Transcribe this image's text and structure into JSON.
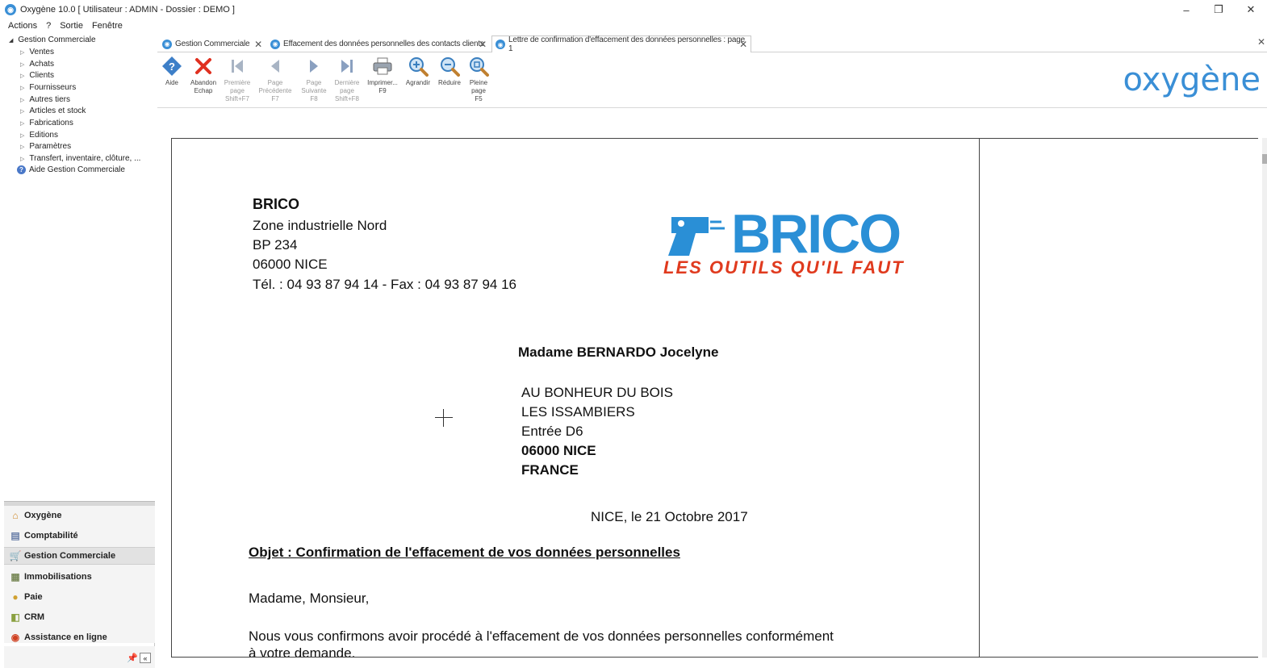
{
  "window": {
    "title": "Oxygène 10.0 [ Utilisateur : ADMIN - Dossier : DEMO ]",
    "minimize": "–",
    "maximize": "❐",
    "close": "✕"
  },
  "menu": [
    "Actions",
    "?",
    "Sortie",
    "Fenêtre"
  ],
  "tree": {
    "root": "Gestion Commerciale",
    "items": [
      "Ventes",
      "Achats",
      "Clients",
      "Fournisseurs",
      "Autres tiers",
      "Articles et stock",
      "Fabrications",
      "Editions",
      "Paramètres",
      "Transfert, inventaire, clôture, ..."
    ],
    "help": "Aide Gestion Commerciale"
  },
  "modules": [
    "Oxygène",
    "Comptabilité",
    "Gestion Commerciale",
    "Immobilisations",
    "Paie",
    "CRM",
    "Assistance en ligne"
  ],
  "tabs": [
    {
      "label": "Gestion Commerciale"
    },
    {
      "label": "Effacement des données personnelles des contacts clients"
    },
    {
      "label": "Lettre de confirmation d'effacement des données personnelles : page 1"
    }
  ],
  "toolbar": [
    {
      "l1": "Aide",
      "l2": "",
      "l3": ""
    },
    {
      "l1": "Abandon",
      "l2": "Echap",
      "l3": ""
    },
    {
      "l1": "Première",
      "l2": "page",
      "l3": "Shift+F7"
    },
    {
      "l1": "Page",
      "l2": "Précédente",
      "l3": "F7"
    },
    {
      "l1": "Page",
      "l2": "Suivante",
      "l3": "F8"
    },
    {
      "l1": "Dernière",
      "l2": "page",
      "l3": "Shift+F8"
    },
    {
      "l1": "Imprimer...",
      "l2": "F9",
      "l3": ""
    },
    {
      "l1": "Agrandir",
      "l2": "",
      "l3": ""
    },
    {
      "l1": "Réduire",
      "l2": "",
      "l3": ""
    },
    {
      "l1": "Pleine",
      "l2": "page",
      "l3": "F5"
    }
  ],
  "brand": "oxygène",
  "letter": {
    "sender_name": "BRICO",
    "sender_line1": "Zone industrielle Nord",
    "sender_line2": "BP 234",
    "sender_line3": "06000 NICE",
    "sender_phone": "Tél. : 04 93 87 94 14 - Fax : 04 93 87 94 16",
    "logo_text": "BRICO",
    "logo_slogan": "LES OUTILS QU'IL FAUT",
    "recipient_name": "Madame BERNARDO Jocelyne",
    "recipient_line1": "AU BONHEUR DU BOIS",
    "recipient_line2": "LES ISSAMBIERS",
    "recipient_line3": "Entrée D6",
    "recipient_line4": "06000 NICE",
    "recipient_line5": "FRANCE",
    "date": "NICE, le 21 Octobre 2017",
    "subject": "Objet : Confirmation de l'effacement de vos données personnelles",
    "salutation": "Madame, Monsieur,",
    "body1": "Nous vous confirmons avoir procédé à l'effacement de vos données personnelles conformément",
    "body2": "à votre demande."
  }
}
